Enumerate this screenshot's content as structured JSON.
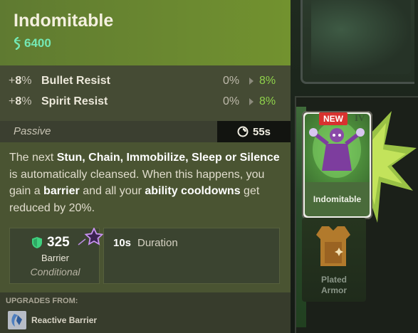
{
  "item": {
    "title": "Indomitable",
    "cost": "6400"
  },
  "stats": [
    {
      "amount": "8",
      "unit": "%",
      "name": "Bullet Resist",
      "from": "0%",
      "to": "8%"
    },
    {
      "amount": "8",
      "unit": "%",
      "name": "Spirit Resist",
      "from": "0%",
      "to": "8%"
    }
  ],
  "passive": {
    "label": "Passive",
    "cooldown": "55s",
    "description": {
      "t1": "The next ",
      "b1": "Stun, Chain, Immobilize, Sleep or Silence",
      "t2": " is automatically cleansed. When this happens, you gain a ",
      "b2": "barrier",
      "t3": " and all your ",
      "b3": "ability cooldowns",
      "t4": " get reduced by 20%."
    },
    "barrier": {
      "value": "325",
      "label": "Barrier",
      "condition": "Conditional"
    },
    "duration": {
      "value": "10s",
      "label": "Duration"
    }
  },
  "upgrades": {
    "title": "UPGRADES FROM:",
    "from_item": "Reactive Barrier"
  },
  "shop": {
    "card_label": "Indomitable",
    "badge": "NEW",
    "tier": "IV",
    "second_card_line1": "Plated",
    "second_card_line2": "Armor"
  },
  "colors": {
    "header_green": "#72922f",
    "cost_teal": "#74e8b4",
    "increase_green": "#8fd14b",
    "shield_green": "#3fd17f",
    "badge_red": "#d8322f"
  },
  "icons": {
    "cost": "souls-icon",
    "cooldown": "cooldown-icon",
    "barrier": "shield-icon",
    "imbue": "star-icon",
    "upgrade": "reactive-barrier-icon"
  }
}
